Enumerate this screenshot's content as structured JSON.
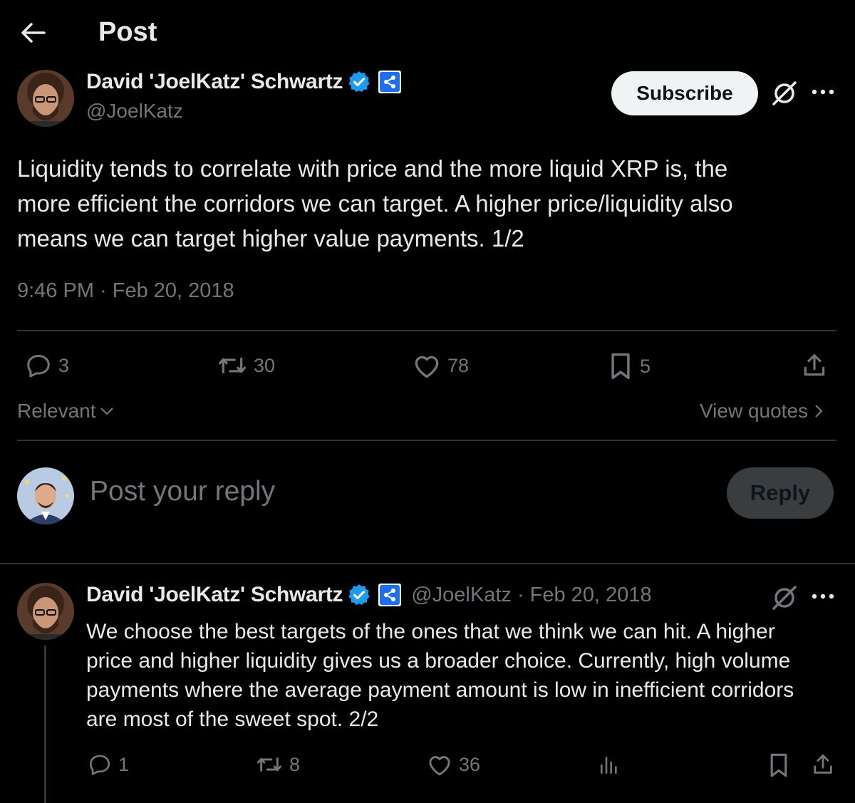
{
  "header": {
    "title": "Post"
  },
  "main_post": {
    "author_name": "David 'JoelKatz' Schwartz",
    "handle": "@JoelKatz",
    "subscribe_label": "Subscribe",
    "text_lines": [
      "Liquidity tends to correlate with price and the more liquid XRP is, the",
      "more efficient the corridors we can target. A higher price/liquidity also",
      "means we can target higher value payments. 1/2"
    ],
    "timestamp": "9:46 PM · Feb 20, 2018",
    "stats": {
      "replies": "3",
      "reposts": "30",
      "likes": "78",
      "bookmarks": "5"
    },
    "sort_label": "Relevant",
    "view_quotes_label": "View quotes"
  },
  "compose": {
    "placeholder": "Post your reply",
    "reply_label": "Reply"
  },
  "reply_post": {
    "author_name": "David 'JoelKatz' Schwartz",
    "handle_date": "@JoelKatz · Feb 20, 2018",
    "text_lines": [
      "We choose the best targets of the ones that we think we can hit. A higher",
      "price and higher liquidity gives us a broader choice. Currently, high volume",
      "payments where the average payment amount is low in inefficient corridors",
      "are most of the sweet spot. 2/2"
    ],
    "stats": {
      "replies": "1",
      "reposts": "8",
      "likes": "36"
    }
  },
  "colors": {
    "background": "#000000",
    "text": "#e7e9ea",
    "muted": "#71767b",
    "verified": "#1d9bf0",
    "affiliate": "#1d6ef0"
  },
  "icons": [
    "back-arrow-icon",
    "verified-badge-icon",
    "ripple-affiliate-icon",
    "grok-slash-icon",
    "more-icon",
    "reply-icon",
    "repost-icon",
    "like-icon",
    "bookmark-icon",
    "share-icon",
    "views-icon",
    "chevron-down-icon",
    "chevron-right-icon"
  ]
}
